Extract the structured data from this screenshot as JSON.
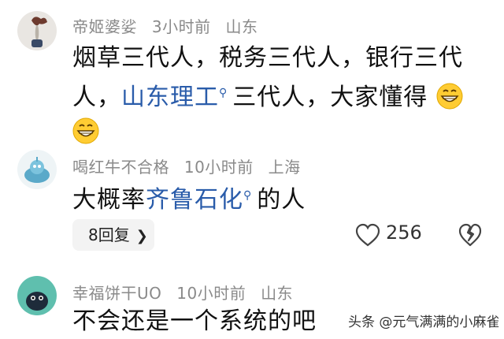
{
  "comments": [
    {
      "username": "帝姬婆娑",
      "time": "3小时前",
      "location": "山东",
      "line1": "烟草三代人，税务三代人，银行三代",
      "line2_pre": "人，",
      "line2_link": "山东理工",
      "line2_post": "三代人，大家懂得"
    },
    {
      "username": "喝红牛不合格",
      "time": "10小时前",
      "location": "上海",
      "text_pre": "大概率",
      "text_link": "齐鲁石化",
      "text_post": "的人",
      "replies_label": "8回复",
      "like_count": "256"
    },
    {
      "username": "幸福饼干UO",
      "time": "10小时前",
      "location": "山东",
      "text": "不会还是一个系统的吧"
    }
  ],
  "watermark": "头条 @元气满满的小麻雀",
  "colors": {
    "link": "#2a5caa",
    "meta": "#8a8a8a"
  }
}
